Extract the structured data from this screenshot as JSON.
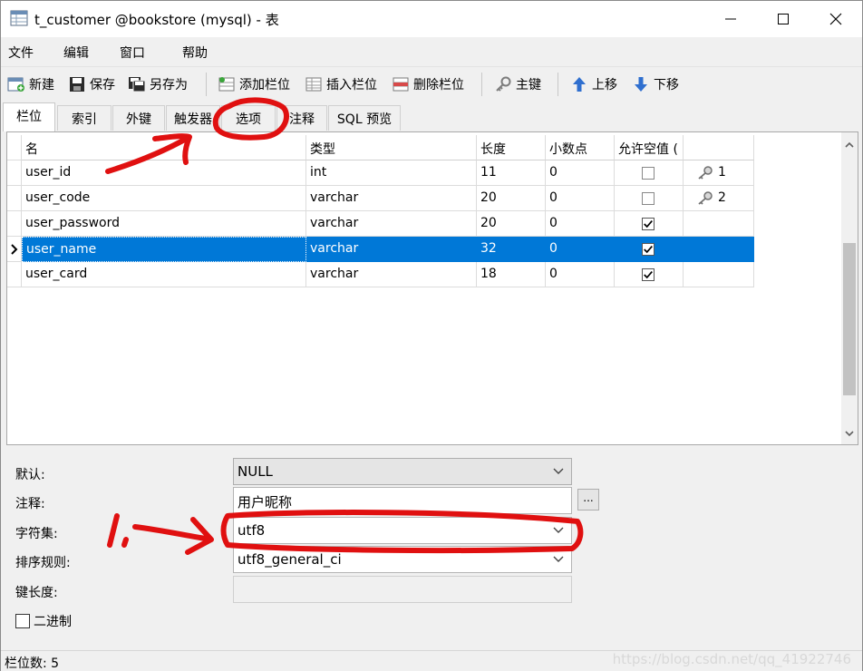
{
  "window": {
    "title": "t_customer @bookstore (mysql) - 表"
  },
  "menu": [
    "文件",
    "编辑",
    "窗口",
    "帮助"
  ],
  "toolbar": {
    "new": "新建",
    "save": "保存",
    "save_as": "另存为",
    "add_field": "添加栏位",
    "insert_field": "插入栏位",
    "delete_field": "删除栏位",
    "primary_key": "主键",
    "move_up": "上移",
    "move_down": "下移"
  },
  "tabs": [
    "栏位",
    "索引",
    "外键",
    "触发器",
    "选项",
    "注释",
    "SQL 预览"
  ],
  "grid": {
    "headers": [
      "名",
      "类型",
      "长度",
      "小数点",
      "允许空值 ("
    ],
    "rows": [
      {
        "name": "user_id",
        "type": "int",
        "length": "11",
        "decimal": "0",
        "nullable": false,
        "key": "1"
      },
      {
        "name": "user_code",
        "type": "varchar",
        "length": "20",
        "decimal": "0",
        "nullable": false,
        "key": "2"
      },
      {
        "name": "user_password",
        "type": "varchar",
        "length": "20",
        "decimal": "0",
        "nullable": true,
        "key": ""
      },
      {
        "name": "user_name",
        "type": "varchar",
        "length": "32",
        "decimal": "0",
        "nullable": true,
        "key": "",
        "selected": true
      },
      {
        "name": "user_card",
        "type": "varchar",
        "length": "18",
        "decimal": "0",
        "nullable": true,
        "key": ""
      }
    ]
  },
  "props": {
    "default_label": "默认:",
    "default_value": "NULL",
    "comment_label": "注释:",
    "comment_value": "用户昵称",
    "comment_btn": "...",
    "charset_label": "字符集:",
    "charset_value": "utf8",
    "collation_label": "排序规则:",
    "collation_value": "utf8_general_ci",
    "key_length_label": "键长度:",
    "key_length_value": "",
    "binary_label": "二进制"
  },
  "status": {
    "text": "栏位数: 5",
    "watermark": "https://blog.csdn.net/qq_41922746"
  },
  "annotations": {
    "marker": "1.",
    "color": "#e01010"
  }
}
